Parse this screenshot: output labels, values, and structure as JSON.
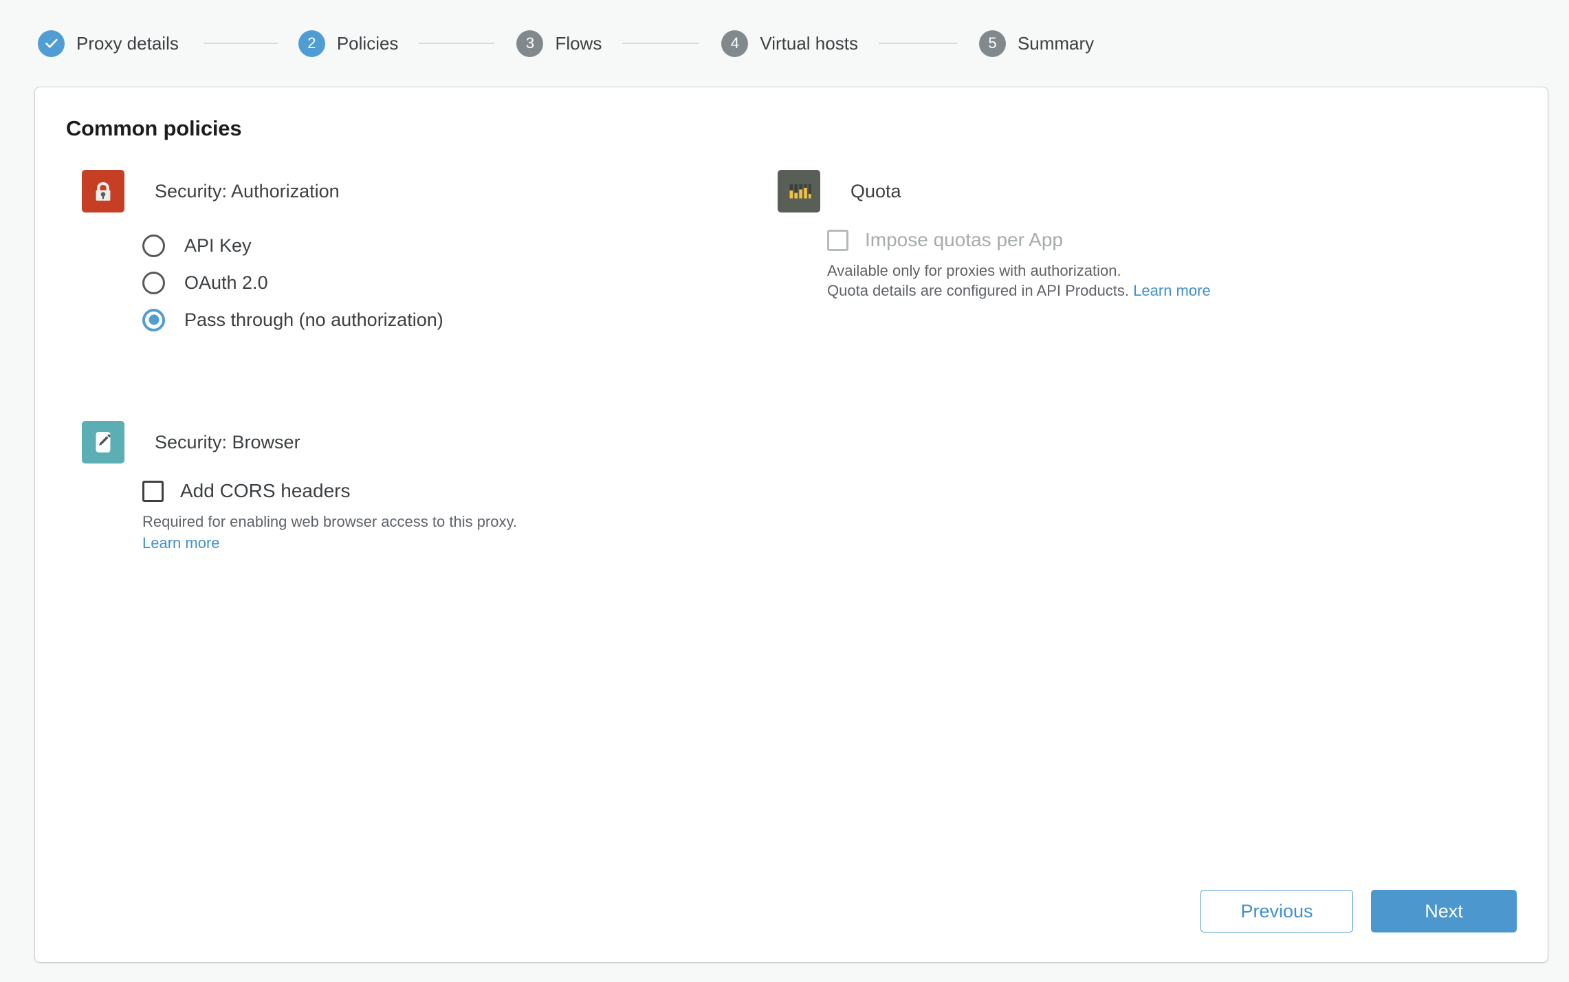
{
  "stepper": {
    "steps": [
      {
        "marker": "check",
        "label": "Proxy details",
        "state": "done"
      },
      {
        "marker": "2",
        "label": "Policies",
        "state": "active"
      },
      {
        "marker": "3",
        "label": "Flows",
        "state": "todo"
      },
      {
        "marker": "4",
        "label": "Virtual hosts",
        "state": "todo"
      },
      {
        "marker": "5",
        "label": "Summary",
        "state": "todo"
      }
    ]
  },
  "card": {
    "title": "Common policies"
  },
  "authorization": {
    "icon": "lock-icon",
    "name": "Security: Authorization",
    "options": [
      {
        "label": "API Key",
        "checked": false
      },
      {
        "label": "OAuth 2.0",
        "checked": false
      },
      {
        "label": "Pass through (no authorization)",
        "checked": true
      }
    ]
  },
  "browser": {
    "icon": "pencil-icon",
    "name": "Security: Browser",
    "checkbox_label": "Add CORS headers",
    "checked": false,
    "help_text": "Required for enabling web browser access to this proxy.",
    "learn_more": "Learn more"
  },
  "quota": {
    "icon": "quota-bars-icon",
    "name": "Quota",
    "checkbox_label": "Impose quotas per App",
    "checked": false,
    "disabled": true,
    "help_line_1": "Available only for proxies with authorization.",
    "help_line_2": "Quota details are configured in API Products.",
    "learn_more": "Learn more"
  },
  "footer": {
    "previous_label": "Previous",
    "next_label": "Next"
  },
  "colors": {
    "accent_blue": "#4f9dd2",
    "primary_button": "#4b97ce",
    "link_blue": "#3f90d0",
    "step_todo_gray": "#82898c",
    "lock_red": "#c63f25",
    "browser_teal": "#5aaeb4",
    "quota_dark": "#585f57",
    "quota_yellow": "#f4c23c",
    "page_bg": "#f7f8f8",
    "card_bg": "#ffffff",
    "card_border": "#c9cccd"
  }
}
